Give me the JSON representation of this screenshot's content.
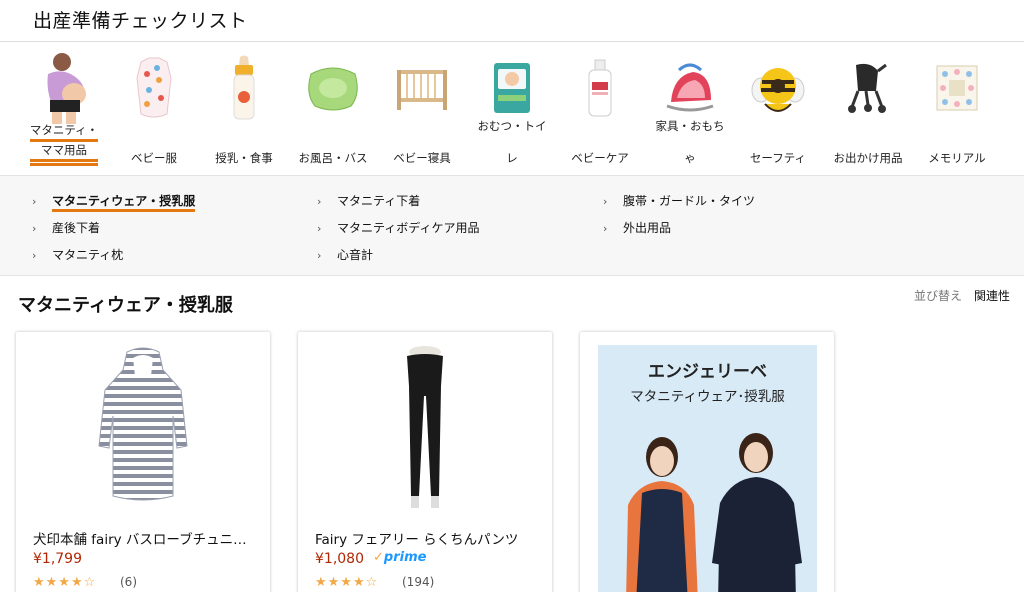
{
  "header": {
    "title": "出産準備チェックリスト"
  },
  "categories": [
    {
      "line1": "マタニティ・",
      "line2": "ママ用品",
      "icon": "pregnant-woman-icon",
      "active": true
    },
    {
      "line1": "",
      "line2": "ベビー服",
      "icon": "baby-clothes-icon"
    },
    {
      "line1": "",
      "line2": "授乳・食事",
      "icon": "baby-bottle-icon"
    },
    {
      "line1": "",
      "line2": "お風呂・バス",
      "icon": "baby-bath-icon"
    },
    {
      "line1": "",
      "line2": "ベビー寝具",
      "icon": "baby-crib-icon"
    },
    {
      "line1": "おむつ・トイ",
      "line2": "レ",
      "icon": "diaper-pack-icon"
    },
    {
      "line1": "",
      "line2": "ベビーケア",
      "icon": "lotion-bottle-icon"
    },
    {
      "line1": "家具・おもち",
      "line2": "ゃ",
      "icon": "baby-bouncer-icon"
    },
    {
      "line1": "",
      "line2": "セーフティ",
      "icon": "bee-cushion-icon"
    },
    {
      "line1": "",
      "line2": "お出かけ用品",
      "icon": "stroller-icon"
    },
    {
      "line1": "",
      "line2": "メモリアル",
      "icon": "memorial-frame-icon"
    }
  ],
  "subcategories": [
    {
      "label": "マタニティウェア・授乳服",
      "active": true
    },
    {
      "label": "マタニティ下着"
    },
    {
      "label": "腹帯・ガードル・タイツ"
    },
    {
      "label": "産後下着"
    },
    {
      "label": "マタニティボディケア用品"
    },
    {
      "label": "外出用品"
    },
    {
      "label": "マタニティ枕"
    },
    {
      "label": "心音計"
    }
  ],
  "section": {
    "title": "マタニティウェア・授乳服"
  },
  "sort": {
    "label": "並び替え",
    "value": "関連性"
  },
  "products": [
    {
      "title": "犬印本舗 fairy バスローブチュニック",
      "price": "¥1,799",
      "stars": "★★★★☆",
      "count": "(6)",
      "prime": false
    },
    {
      "title": "Fairy フェアリー らくちんパンツ",
      "price": "¥1,080",
      "stars": "★★★★☆",
      "count": "(194)",
      "prime": true,
      "prime_label": "prime"
    }
  ],
  "banner": {
    "title": "エンジェリーベ",
    "subtitle": "マタニティウェア･授乳服"
  },
  "colors": {
    "accent": "#e47911",
    "price": "#b12704",
    "prime": "#1a98ff",
    "stars": "#f3a847"
  }
}
